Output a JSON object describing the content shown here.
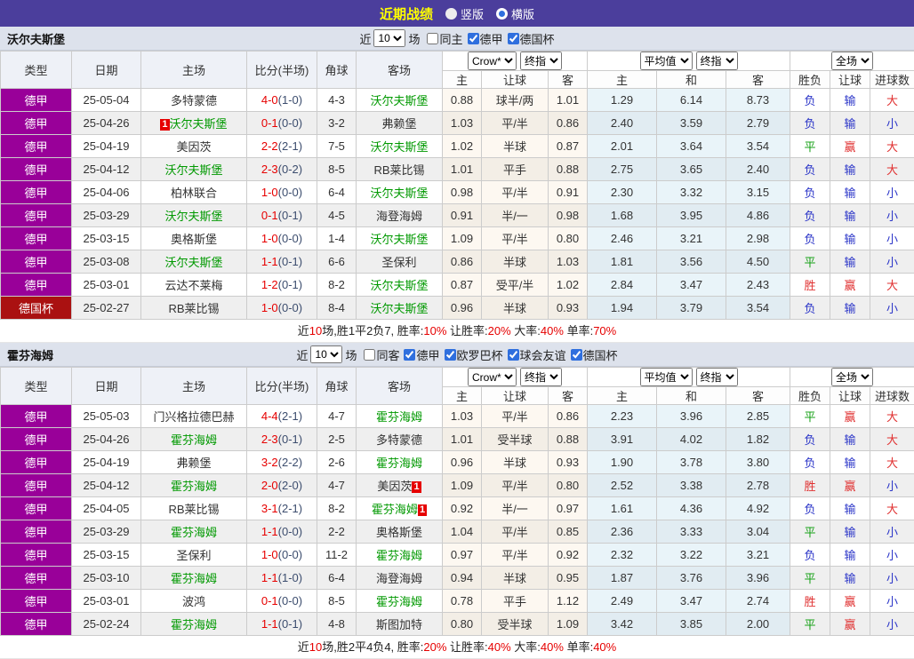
{
  "topbar": {
    "title": "近期战绩",
    "options": [
      {
        "label": "竖版",
        "selected": false
      },
      {
        "label": "横版",
        "selected": true
      }
    ]
  },
  "colors": {
    "topbar_bg": "#4b3e9c",
    "title_text": "#ffff00",
    "league_badge": "#990099",
    "cup_badge": "#aa1111",
    "self_team_green": "#009900",
    "score_red": "#e60000",
    "win_red": "#e03030",
    "lose_blue": "#2b35c8",
    "draw_green": "#16a016"
  },
  "sections": [
    {
      "team": "沃尔夫斯堡",
      "filter": {
        "prefix": "近",
        "count": "10",
        "suffix": "场",
        "checkboxes": [
          {
            "label": "同主",
            "checked": false
          },
          {
            "label": "德甲",
            "checked": true
          },
          {
            "label": "德国杯",
            "checked": true
          }
        ]
      },
      "table_header": {
        "type": "类型",
        "date": "日期",
        "home": "主场",
        "score": "比分(半场)",
        "corner": "角球",
        "away": "客场",
        "odds_select": "Crow*",
        "odds_select2": "终指",
        "odds_cols": [
          "主",
          "让球",
          "客"
        ],
        "avg_select": "平均值",
        "avg_select2": "终指",
        "avg_cols": [
          "主",
          "和",
          "客"
        ],
        "result_select": "全场",
        "result_cols": [
          "胜负",
          "让球",
          "进球数"
        ]
      },
      "rows": [
        {
          "league": "德甲",
          "is_cup": false,
          "date": "25-05-04",
          "home": {
            "name": "多特蒙德",
            "is_self": false
          },
          "score_ft": "4-0",
          "score_ht": "(1-0)",
          "corners": "4-3",
          "away": {
            "name": "沃尔夫斯堡",
            "is_self": true
          },
          "odds": [
            "0.88",
            "球半/两",
            "1.01"
          ],
          "avg": [
            "1.29",
            "6.14",
            "8.73"
          ],
          "results": [
            [
              "负",
              "b"
            ],
            [
              "输",
              "b"
            ],
            [
              "大",
              "r"
            ]
          ]
        },
        {
          "league": "德甲",
          "is_cup": false,
          "date": "25-04-26",
          "home": {
            "name": "沃尔夫斯堡",
            "is_self": true,
            "red_card": "1",
            "card_pos": "before"
          },
          "score_ft": "0-1",
          "score_ht": "(0-0)",
          "corners": "3-2",
          "away": {
            "name": "弗赖堡",
            "is_self": false
          },
          "odds": [
            "1.03",
            "平/半",
            "0.86"
          ],
          "avg": [
            "2.40",
            "3.59",
            "2.79"
          ],
          "results": [
            [
              "负",
              "b"
            ],
            [
              "输",
              "b"
            ],
            [
              "小",
              "b"
            ]
          ]
        },
        {
          "league": "德甲",
          "is_cup": false,
          "date": "25-04-19",
          "home": {
            "name": "美因茨",
            "is_self": false
          },
          "score_ft": "2-2",
          "score_ht": "(2-1)",
          "corners": "7-5",
          "away": {
            "name": "沃尔夫斯堡",
            "is_self": true
          },
          "odds": [
            "1.02",
            "半球",
            "0.87"
          ],
          "avg": [
            "2.01",
            "3.64",
            "3.54"
          ],
          "results": [
            [
              "平",
              "g"
            ],
            [
              "赢",
              "r"
            ],
            [
              "大",
              "r"
            ]
          ]
        },
        {
          "league": "德甲",
          "is_cup": false,
          "date": "25-04-12",
          "home": {
            "name": "沃尔夫斯堡",
            "is_self": true
          },
          "score_ft": "2-3",
          "score_ht": "(0-2)",
          "corners": "8-5",
          "away": {
            "name": "RB莱比锡",
            "is_self": false
          },
          "odds": [
            "1.01",
            "平手",
            "0.88"
          ],
          "avg": [
            "2.75",
            "3.65",
            "2.40"
          ],
          "results": [
            [
              "负",
              "b"
            ],
            [
              "输",
              "b"
            ],
            [
              "大",
              "r"
            ]
          ]
        },
        {
          "league": "德甲",
          "is_cup": false,
          "date": "25-04-06",
          "home": {
            "name": "柏林联合",
            "is_self": false
          },
          "score_ft": "1-0",
          "score_ht": "(0-0)",
          "corners": "6-4",
          "away": {
            "name": "沃尔夫斯堡",
            "is_self": true
          },
          "odds": [
            "0.98",
            "平/半",
            "0.91"
          ],
          "avg": [
            "2.30",
            "3.32",
            "3.15"
          ],
          "results": [
            [
              "负",
              "b"
            ],
            [
              "输",
              "b"
            ],
            [
              "小",
              "b"
            ]
          ]
        },
        {
          "league": "德甲",
          "is_cup": false,
          "date": "25-03-29",
          "home": {
            "name": "沃尔夫斯堡",
            "is_self": true
          },
          "score_ft": "0-1",
          "score_ht": "(0-1)",
          "corners": "4-5",
          "away": {
            "name": "海登海姆",
            "is_self": false
          },
          "odds": [
            "0.91",
            "半/一",
            "0.98"
          ],
          "avg": [
            "1.68",
            "3.95",
            "4.86"
          ],
          "results": [
            [
              "负",
              "b"
            ],
            [
              "输",
              "b"
            ],
            [
              "小",
              "b"
            ]
          ]
        },
        {
          "league": "德甲",
          "is_cup": false,
          "date": "25-03-15",
          "home": {
            "name": "奥格斯堡",
            "is_self": false
          },
          "score_ft": "1-0",
          "score_ht": "(0-0)",
          "corners": "1-4",
          "away": {
            "name": "沃尔夫斯堡",
            "is_self": true
          },
          "odds": [
            "1.09",
            "平/半",
            "0.80"
          ],
          "avg": [
            "2.46",
            "3.21",
            "2.98"
          ],
          "results": [
            [
              "负",
              "b"
            ],
            [
              "输",
              "b"
            ],
            [
              "小",
              "b"
            ]
          ]
        },
        {
          "league": "德甲",
          "is_cup": false,
          "date": "25-03-08",
          "home": {
            "name": "沃尔夫斯堡",
            "is_self": true
          },
          "score_ft": "1-1",
          "score_ht": "(0-1)",
          "corners": "6-6",
          "away": {
            "name": "圣保利",
            "is_self": false
          },
          "odds": [
            "0.86",
            "半球",
            "1.03"
          ],
          "avg": [
            "1.81",
            "3.56",
            "4.50"
          ],
          "results": [
            [
              "平",
              "g"
            ],
            [
              "输",
              "b"
            ],
            [
              "小",
              "b"
            ]
          ]
        },
        {
          "league": "德甲",
          "is_cup": false,
          "date": "25-03-01",
          "home": {
            "name": "云达不莱梅",
            "is_self": false
          },
          "score_ft": "1-2",
          "score_ht": "(0-1)",
          "corners": "8-2",
          "away": {
            "name": "沃尔夫斯堡",
            "is_self": true
          },
          "odds": [
            "0.87",
            "受平/半",
            "1.02"
          ],
          "avg": [
            "2.84",
            "3.47",
            "2.43"
          ],
          "results": [
            [
              "胜",
              "r"
            ],
            [
              "赢",
              "r"
            ],
            [
              "大",
              "r"
            ]
          ]
        },
        {
          "league": "德国杯",
          "is_cup": true,
          "date": "25-02-27",
          "home": {
            "name": "RB莱比锡",
            "is_self": false
          },
          "score_ft": "1-0",
          "score_ht": "(0-0)",
          "corners": "8-4",
          "away": {
            "name": "沃尔夫斯堡",
            "is_self": true
          },
          "odds": [
            "0.96",
            "半球",
            "0.93"
          ],
          "avg": [
            "1.94",
            "3.79",
            "3.54"
          ],
          "results": [
            [
              "负",
              "b"
            ],
            [
              "输",
              "b"
            ],
            [
              "小",
              "b"
            ]
          ]
        }
      ],
      "summary": [
        {
          "text": "近",
          "red": false
        },
        {
          "text": "10",
          "red": true
        },
        {
          "text": "场,胜1平2负7, 胜率:",
          "red": false
        },
        {
          "text": "10%",
          "red": true
        },
        {
          "text": " 让胜率:",
          "red": false
        },
        {
          "text": "20%",
          "red": true
        },
        {
          "text": " 大率:",
          "red": false
        },
        {
          "text": "40%",
          "red": true
        },
        {
          "text": " 单率:",
          "red": false
        },
        {
          "text": "70%",
          "red": true
        }
      ]
    },
    {
      "team": "霍芬海姆",
      "filter": {
        "prefix": "近",
        "count": "10",
        "suffix": "场",
        "checkboxes": [
          {
            "label": "同客",
            "checked": false
          },
          {
            "label": "德甲",
            "checked": true
          },
          {
            "label": "欧罗巴杯",
            "checked": true
          },
          {
            "label": "球会友谊",
            "checked": true
          },
          {
            "label": "德国杯",
            "checked": true
          }
        ]
      },
      "table_header": {
        "type": "类型",
        "date": "日期",
        "home": "主场",
        "score": "比分(半场)",
        "corner": "角球",
        "away": "客场",
        "odds_select": "Crow*",
        "odds_select2": "终指",
        "odds_cols": [
          "主",
          "让球",
          "客"
        ],
        "avg_select": "平均值",
        "avg_select2": "终指",
        "avg_cols": [
          "主",
          "和",
          "客"
        ],
        "result_select": "全场",
        "result_cols": [
          "胜负",
          "让球",
          "进球数"
        ]
      },
      "rows": [
        {
          "league": "德甲",
          "is_cup": false,
          "date": "25-05-03",
          "home": {
            "name": "门兴格拉德巴赫",
            "is_self": false
          },
          "score_ft": "4-4",
          "score_ht": "(2-1)",
          "corners": "4-7",
          "away": {
            "name": "霍芬海姆",
            "is_self": true
          },
          "odds": [
            "1.03",
            "平/半",
            "0.86"
          ],
          "avg": [
            "2.23",
            "3.96",
            "2.85"
          ],
          "results": [
            [
              "平",
              "g"
            ],
            [
              "赢",
              "r"
            ],
            [
              "大",
              "r"
            ]
          ]
        },
        {
          "league": "德甲",
          "is_cup": false,
          "date": "25-04-26",
          "home": {
            "name": "霍芬海姆",
            "is_self": true
          },
          "score_ft": "2-3",
          "score_ht": "(0-1)",
          "corners": "2-5",
          "away": {
            "name": "多特蒙德",
            "is_self": false
          },
          "odds": [
            "1.01",
            "受半球",
            "0.88"
          ],
          "avg": [
            "3.91",
            "4.02",
            "1.82"
          ],
          "results": [
            [
              "负",
              "b"
            ],
            [
              "输",
              "b"
            ],
            [
              "大",
              "r"
            ]
          ]
        },
        {
          "league": "德甲",
          "is_cup": false,
          "date": "25-04-19",
          "home": {
            "name": "弗赖堡",
            "is_self": false
          },
          "score_ft": "3-2",
          "score_ht": "(2-2)",
          "corners": "2-6",
          "away": {
            "name": "霍芬海姆",
            "is_self": true
          },
          "odds": [
            "0.96",
            "半球",
            "0.93"
          ],
          "avg": [
            "1.90",
            "3.78",
            "3.80"
          ],
          "results": [
            [
              "负",
              "b"
            ],
            [
              "输",
              "b"
            ],
            [
              "大",
              "r"
            ]
          ]
        },
        {
          "league": "德甲",
          "is_cup": false,
          "date": "25-04-12",
          "home": {
            "name": "霍芬海姆",
            "is_self": true
          },
          "score_ft": "2-0",
          "score_ht": "(2-0)",
          "corners": "4-7",
          "away": {
            "name": "美因茨",
            "is_self": false,
            "red_card": "1",
            "card_pos": "after"
          },
          "odds": [
            "1.09",
            "平/半",
            "0.80"
          ],
          "avg": [
            "2.52",
            "3.38",
            "2.78"
          ],
          "results": [
            [
              "胜",
              "r"
            ],
            [
              "赢",
              "r"
            ],
            [
              "小",
              "b"
            ]
          ]
        },
        {
          "league": "德甲",
          "is_cup": false,
          "date": "25-04-05",
          "home": {
            "name": "RB莱比锡",
            "is_self": false
          },
          "score_ft": "3-1",
          "score_ht": "(2-1)",
          "corners": "8-2",
          "away": {
            "name": "霍芬海姆",
            "is_self": true,
            "red_card": "1",
            "card_pos": "after"
          },
          "odds": [
            "0.92",
            "半/一",
            "0.97"
          ],
          "avg": [
            "1.61",
            "4.36",
            "4.92"
          ],
          "results": [
            [
              "负",
              "b"
            ],
            [
              "输",
              "b"
            ],
            [
              "大",
              "r"
            ]
          ]
        },
        {
          "league": "德甲",
          "is_cup": false,
          "date": "25-03-29",
          "home": {
            "name": "霍芬海姆",
            "is_self": true
          },
          "score_ft": "1-1",
          "score_ht": "(0-0)",
          "corners": "2-2",
          "away": {
            "name": "奥格斯堡",
            "is_self": false
          },
          "odds": [
            "1.04",
            "平/半",
            "0.85"
          ],
          "avg": [
            "2.36",
            "3.33",
            "3.04"
          ],
          "results": [
            [
              "平",
              "g"
            ],
            [
              "输",
              "b"
            ],
            [
              "小",
              "b"
            ]
          ]
        },
        {
          "league": "德甲",
          "is_cup": false,
          "date": "25-03-15",
          "home": {
            "name": "圣保利",
            "is_self": false
          },
          "score_ft": "1-0",
          "score_ht": "(0-0)",
          "corners": "11-2",
          "away": {
            "name": "霍芬海姆",
            "is_self": true
          },
          "odds": [
            "0.97",
            "平/半",
            "0.92"
          ],
          "avg": [
            "2.32",
            "3.22",
            "3.21"
          ],
          "results": [
            [
              "负",
              "b"
            ],
            [
              "输",
              "b"
            ],
            [
              "小",
              "b"
            ]
          ]
        },
        {
          "league": "德甲",
          "is_cup": false,
          "date": "25-03-10",
          "home": {
            "name": "霍芬海姆",
            "is_self": true
          },
          "score_ft": "1-1",
          "score_ht": "(1-0)",
          "corners": "6-4",
          "away": {
            "name": "海登海姆",
            "is_self": false
          },
          "odds": [
            "0.94",
            "半球",
            "0.95"
          ],
          "avg": [
            "1.87",
            "3.76",
            "3.96"
          ],
          "results": [
            [
              "平",
              "g"
            ],
            [
              "输",
              "b"
            ],
            [
              "小",
              "b"
            ]
          ]
        },
        {
          "league": "德甲",
          "is_cup": false,
          "date": "25-03-01",
          "home": {
            "name": "波鸿",
            "is_self": false
          },
          "score_ft": "0-1",
          "score_ht": "(0-0)",
          "corners": "8-5",
          "away": {
            "name": "霍芬海姆",
            "is_self": true
          },
          "odds": [
            "0.78",
            "平手",
            "1.12"
          ],
          "avg": [
            "2.49",
            "3.47",
            "2.74"
          ],
          "results": [
            [
              "胜",
              "r"
            ],
            [
              "赢",
              "r"
            ],
            [
              "小",
              "b"
            ]
          ]
        },
        {
          "league": "德甲",
          "is_cup": false,
          "date": "25-02-24",
          "home": {
            "name": "霍芬海姆",
            "is_self": true
          },
          "score_ft": "1-1",
          "score_ht": "(0-1)",
          "corners": "4-8",
          "away": {
            "name": "斯图加特",
            "is_self": false
          },
          "odds": [
            "0.80",
            "受半球",
            "1.09"
          ],
          "avg": [
            "3.42",
            "3.85",
            "2.00"
          ],
          "results": [
            [
              "平",
              "g"
            ],
            [
              "赢",
              "r"
            ],
            [
              "小",
              "b"
            ]
          ]
        }
      ],
      "summary": [
        {
          "text": "近",
          "red": false
        },
        {
          "text": "10",
          "red": true
        },
        {
          "text": "场,胜2平4负4, 胜率:",
          "red": false
        },
        {
          "text": "20%",
          "red": true
        },
        {
          "text": " 让胜率:",
          "red": false
        },
        {
          "text": "40%",
          "red": true
        },
        {
          "text": " 大率:",
          "red": false
        },
        {
          "text": "40%",
          "red": true
        },
        {
          "text": " 单率:",
          "red": false
        },
        {
          "text": "40%",
          "red": true
        }
      ]
    }
  ]
}
